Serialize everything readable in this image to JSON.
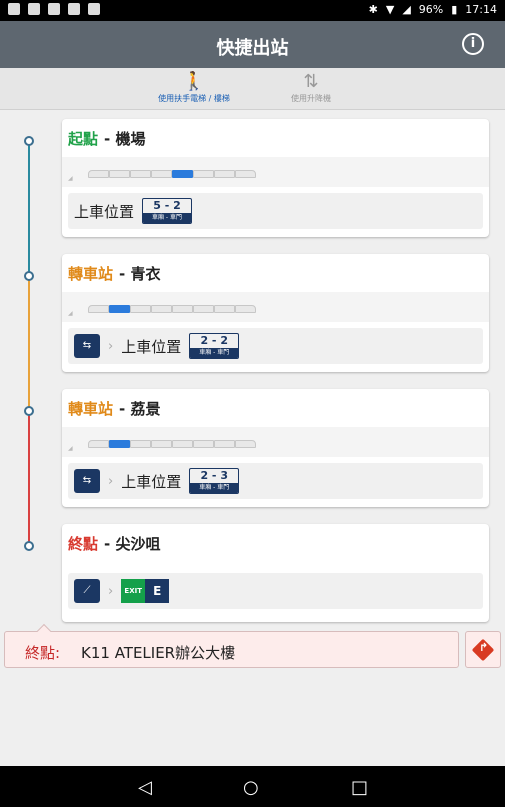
{
  "status_bar": {
    "battery": "96%",
    "time": "17:14"
  },
  "app_bar": {
    "title": "快捷出站",
    "info_icon": "info-icon"
  },
  "modes": [
    {
      "label": "使用扶手電梯 / 樓梯",
      "icon": "walking-icon",
      "active": true
    },
    {
      "label": "使用升降機",
      "icon": "elevator-icon",
      "active": false
    }
  ],
  "timeline_colors": [
    "#2a8a9f",
    "#e8a23a",
    "#d94040"
  ],
  "cards": [
    {
      "kind": "起點",
      "kind_color": "#21a24a",
      "station": "機場",
      "position_label": "上車位置",
      "position": "5 - 2",
      "door_caption": "車廂 - 車門",
      "selected_car": 4
    },
    {
      "kind": "轉車站",
      "kind_color": "#e08a1a",
      "station": "青衣",
      "position_label": "上車位置",
      "position": "2 - 2",
      "door_caption": "車廂 - 車門",
      "selected_car": 1
    },
    {
      "kind": "轉車站",
      "kind_color": "#e08a1a",
      "station": "荔景",
      "position_label": "上車位置",
      "position": "2 - 3",
      "door_caption": "車廂 - 車門",
      "selected_car": 1
    },
    {
      "kind": "終點",
      "kind_color": "#d83a30",
      "station": "尖沙咀",
      "exit_caption": "EXIT",
      "exit_letter": "E"
    }
  ],
  "separator": "-",
  "destination": {
    "label": "終點:",
    "value": "K11 ATELIER辦公大樓"
  }
}
